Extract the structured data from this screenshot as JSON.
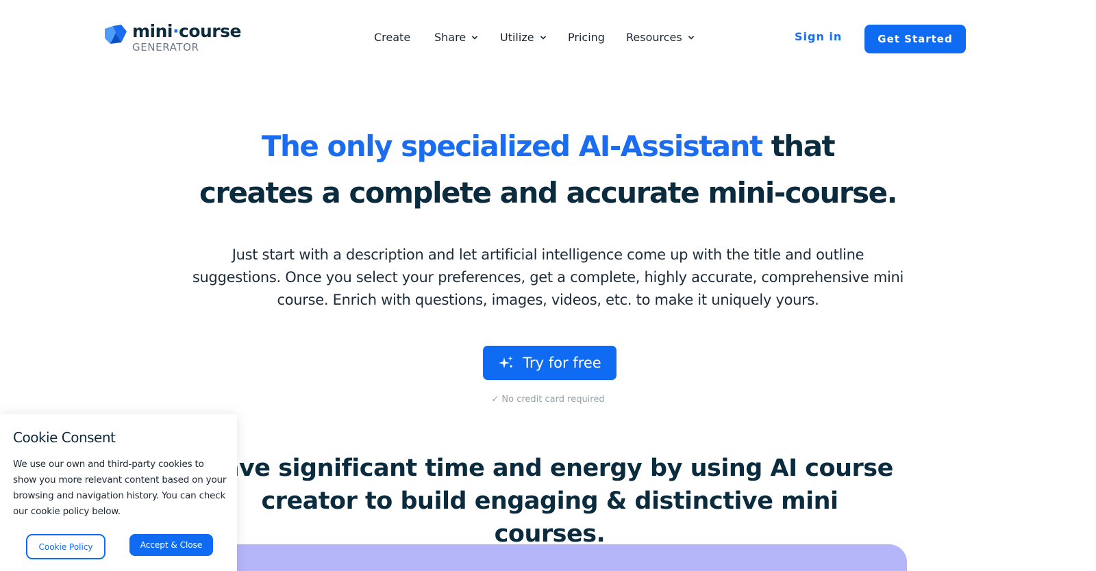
{
  "logo": {
    "name_part1": "mini",
    "separator": "·",
    "name_part2": "course",
    "tagline": "GENERATOR"
  },
  "nav": {
    "items": [
      {
        "label": "Create",
        "has_dropdown": false
      },
      {
        "label": "Share",
        "has_dropdown": true
      },
      {
        "label": "Utilize",
        "has_dropdown": true
      },
      {
        "label": "Pricing",
        "has_dropdown": false
      },
      {
        "label": "Resources",
        "has_dropdown": true
      }
    ],
    "sign_in": "Sign in",
    "get_started": "Get Started"
  },
  "hero": {
    "title_accent": "The only specialized AI-Assistant",
    "title_rest_1": " that",
    "title_line2": "creates a complete and accurate mini-course.",
    "subtitle": "Just start with a description and let artificial intelligence come up with the title and outline suggestions. Once you select your preferences, get a complete, highly accurate, comprehensive mini course. Enrich with questions, images, videos, etc. to make it uniquely yours.",
    "cta_label": "Try for free",
    "cta_icon": "sparkles-icon",
    "note": "✓ No credit card required"
  },
  "section2": {
    "title": "Save significant time and energy by using AI course creator to build engaging & distinctive mini courses."
  },
  "cookie": {
    "title": "Cookie Consent",
    "body": "We use our own and third-party cookies to show you more relevant content based on your browsing and navigation history. You can check our cookie policy below.",
    "policy_button": "Cookie Policy",
    "accept_button": "Accept & Close"
  },
  "colors": {
    "brand_blue": "#0f6cf2",
    "accent_text": "#1a6cf0",
    "heading_dark": "#0b2b3f",
    "preview_purple": "#b5b6f9"
  }
}
